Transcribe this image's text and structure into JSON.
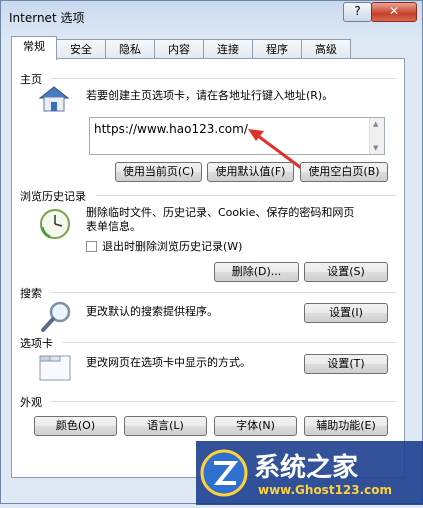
{
  "window": {
    "title": "Internet 选项",
    "help_glyph": "?",
    "close_glyph": "✕"
  },
  "tabs": [
    "常规",
    "安全",
    "隐私",
    "内容",
    "连接",
    "程序",
    "高级"
  ],
  "home": {
    "label": "主页",
    "description": "若要创建主页选项卡，请在各地址行键入地址(R)。",
    "url": "https://www.hao123.com/",
    "buttons": [
      "使用当前页(C)",
      "使用默认值(F)",
      "使用空白页(B)"
    ]
  },
  "history": {
    "label": "浏览历史记录",
    "description_line1": "删除临时文件、历史记录、Cookie、保存的密码和网页",
    "description_line2": "表单信息。",
    "checkbox_label": "退出时删除浏览历史记录(W)",
    "delete_button": "删除(D)...",
    "settings_button": "设置(S)"
  },
  "search": {
    "label": "搜索",
    "description": "更改默认的搜索提供程序。",
    "settings_button": "设置(I)"
  },
  "tabs_section": {
    "label": "选项卡",
    "description": "更改网页在选项卡中显示的方式。",
    "settings_button": "设置(T)"
  },
  "appearance": {
    "label": "外观",
    "buttons": [
      "颜色(O)",
      "语言(L)",
      "字体(N)",
      "辅助功能(E)"
    ]
  },
  "watermark": {
    "brand": "系统之家",
    "site": "www.Ghost123.com"
  },
  "colors": {
    "accent_arrow": "#e0302a",
    "panel_bg": "#ffffff",
    "frame": "#dfe9f5"
  }
}
